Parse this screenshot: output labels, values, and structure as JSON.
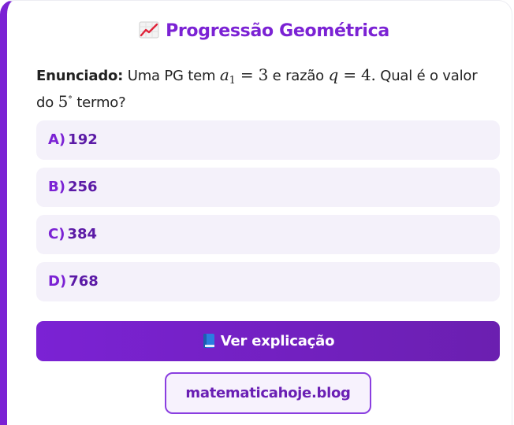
{
  "card": {
    "title": "Progressão Geométrica",
    "title_icon": "chart-increasing-icon",
    "statement": {
      "label": "Enunciado:",
      "text_1": "Uma PG tem",
      "math_a1_var": "a",
      "math_a1_sub": "1",
      "math_a1_rest": "= 3",
      "text_2": "e razão",
      "math_q": "q",
      "math_q_rest": "= 4.",
      "text_3": "Qual é o valor do",
      "math_term_num": "5",
      "math_term_sup": "∘",
      "text_4": "termo?"
    },
    "options": [
      {
        "letter": "A)",
        "value": "192"
      },
      {
        "letter": "B)",
        "value": "256"
      },
      {
        "letter": "C)",
        "value": "384"
      },
      {
        "letter": "D)",
        "value": "768"
      }
    ],
    "explain_button": {
      "label": "Ver explicação",
      "icon": "blue-book-icon"
    },
    "blog_link": {
      "label": "matematicahoje.blog"
    }
  },
  "colors": {
    "accent": "#7b22d4",
    "option_bg": "#f4f1fa",
    "option_text": "#5b1aa6",
    "button_gradient_end": "#6b1fb0"
  }
}
